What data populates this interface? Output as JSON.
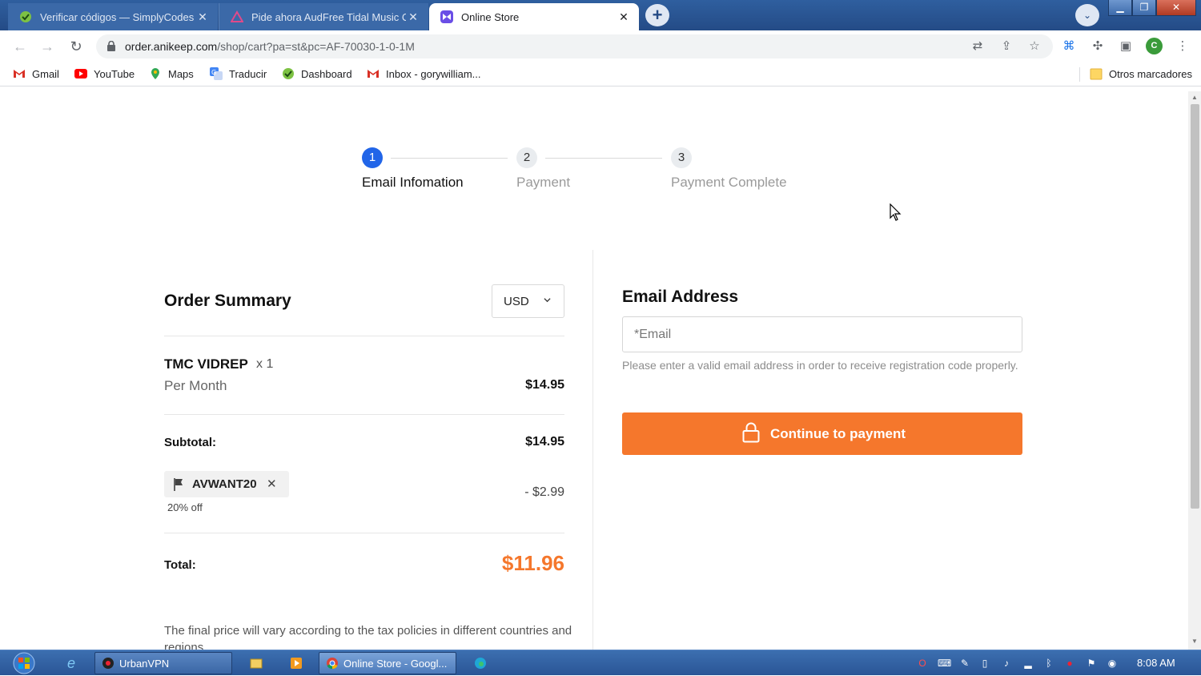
{
  "browser": {
    "tabs": [
      {
        "title": "Verificar códigos — SimplyCodes",
        "active": false,
        "icon": "simplycodes-icon"
      },
      {
        "title": "Pide ahora AudFree Tidal Music C",
        "active": false,
        "icon": "audfree-icon"
      },
      {
        "title": "Online Store",
        "active": true,
        "icon": "store-icon"
      }
    ],
    "new_tab_label": "+",
    "window_controls": {
      "minimize": "▁",
      "maximize": "❐",
      "close": "✕"
    },
    "url_host": "order.anikeep.com",
    "url_path": "/shop/cart?pa=st&pc=AF-70030-1-0-1M",
    "profile_initial": "C",
    "bookmarks": [
      {
        "label": "Gmail",
        "icon": "gmail-icon"
      },
      {
        "label": "YouTube",
        "icon": "youtube-icon"
      },
      {
        "label": "Maps",
        "icon": "maps-icon"
      },
      {
        "label": "Traducir",
        "icon": "translate-icon"
      },
      {
        "label": "Dashboard",
        "icon": "dashboard-icon"
      },
      {
        "label": "Inbox - gorywilliam...",
        "icon": "gmail-icon"
      }
    ],
    "other_bookmarks": "Otros marcadores"
  },
  "checkout": {
    "steps": [
      {
        "number": "1",
        "label": "Email Infomation",
        "state": "current"
      },
      {
        "number": "2",
        "label": "Payment",
        "state": "future"
      },
      {
        "number": "3",
        "label": "Payment Complete",
        "state": "future"
      }
    ],
    "order_summary": {
      "title": "Order Summary",
      "currency": "USD",
      "product": {
        "name": "TMC VIDREP",
        "qty": "x 1",
        "period": "Per Month",
        "price": "$14.95"
      },
      "subtotal_label": "Subtotal:",
      "subtotal_value": "$14.95",
      "coupon": {
        "code": "AVWANT20",
        "remove": "✕",
        "percent": "20% off",
        "discount": "- $2.99"
      },
      "total_label": "Total:",
      "total_value": "$11.96",
      "tax_note": "The final price will vary according to the tax policies in different countries and regions."
    },
    "email": {
      "heading": "Email Address",
      "placeholder": "*Email",
      "value": "",
      "hint": "Please enter a valid email address in order to receive registration code properly."
    },
    "pay_button": "Continue to payment",
    "colors": {
      "accent": "#f5772c",
      "step_active": "#2165e8"
    }
  },
  "taskbar": {
    "apps": [
      {
        "label": "UrbanVPN",
        "icon": "urbanvpn-icon"
      },
      {
        "label": "Online Store - Googl...",
        "icon": "chrome-icon"
      }
    ],
    "clock": "8:08 AM"
  }
}
